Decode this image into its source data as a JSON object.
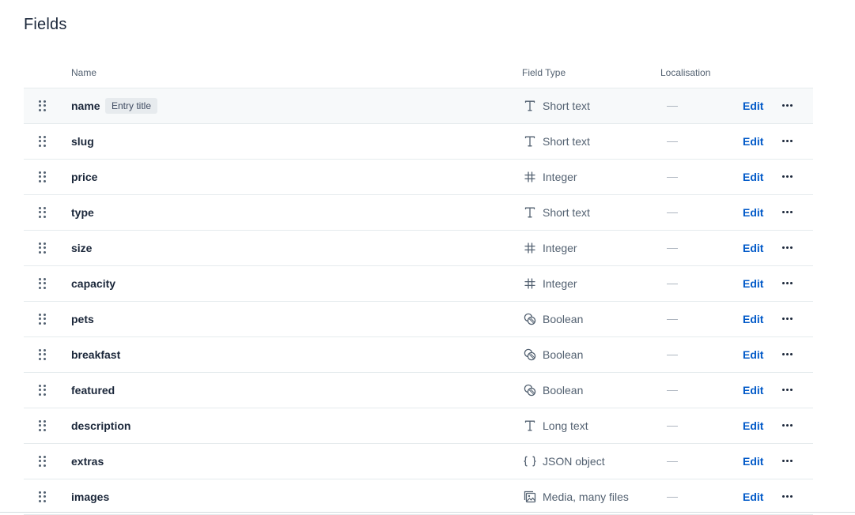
{
  "page": {
    "title": "Fields"
  },
  "columns": {
    "name": "Name",
    "field_type": "Field Type",
    "localisation": "Localisation"
  },
  "rows": [
    {
      "name": "name",
      "badge": "Entry title",
      "type_icon": "text-icon",
      "type": "Short text",
      "localisation": "—",
      "action": "Edit",
      "highlight": true
    },
    {
      "name": "slug",
      "type_icon": "text-icon",
      "type": "Short text",
      "localisation": "—",
      "action": "Edit"
    },
    {
      "name": "price",
      "type_icon": "hash-icon",
      "type": "Integer",
      "localisation": "—",
      "action": "Edit"
    },
    {
      "name": "type",
      "type_icon": "text-icon",
      "type": "Short text",
      "localisation": "—",
      "action": "Edit"
    },
    {
      "name": "size",
      "type_icon": "hash-icon",
      "type": "Integer",
      "localisation": "—",
      "action": "Edit"
    },
    {
      "name": "capacity",
      "type_icon": "hash-icon",
      "type": "Integer",
      "localisation": "—",
      "action": "Edit"
    },
    {
      "name": "pets",
      "type_icon": "boolean-icon",
      "type": "Boolean",
      "localisation": "—",
      "action": "Edit"
    },
    {
      "name": "breakfast",
      "type_icon": "boolean-icon",
      "type": "Boolean",
      "localisation": "—",
      "action": "Edit"
    },
    {
      "name": "featured",
      "type_icon": "boolean-icon",
      "type": "Boolean",
      "localisation": "—",
      "action": "Edit"
    },
    {
      "name": "description",
      "type_icon": "text-icon",
      "type": "Long text",
      "localisation": "—",
      "action": "Edit"
    },
    {
      "name": "extras",
      "type_icon": "json-icon",
      "type": "JSON object",
      "localisation": "—",
      "action": "Edit"
    },
    {
      "name": "images",
      "type_icon": "media-icon",
      "type": "Media, many files",
      "localisation": "—",
      "action": "Edit"
    }
  ],
  "colors": {
    "link": "#0059c8",
    "muted": "#536171",
    "text": "#1b273a",
    "row_highlight": "#f7f9fa",
    "badge_bg": "#e7ebee"
  }
}
